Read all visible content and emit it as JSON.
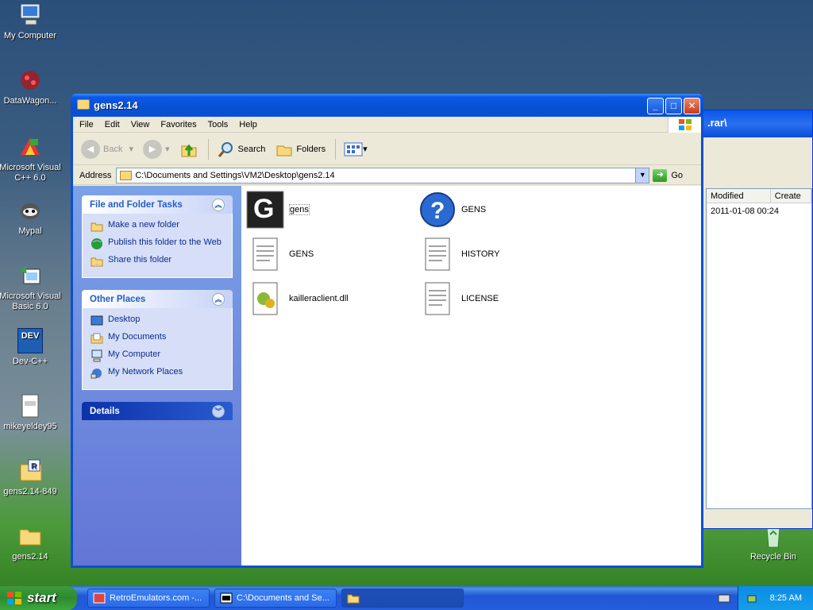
{
  "desktop": {
    "icons": [
      {
        "label": "My Computer"
      },
      {
        "label": "DataWagon..."
      },
      {
        "label": "Microsoft Visual C++ 6.0"
      },
      {
        "label": "Mypal"
      },
      {
        "label": "Microsoft Visual Basic 6.0"
      },
      {
        "label": "Dev-C++"
      },
      {
        "label": "mikeyeldey95"
      },
      {
        "label": "gens2.14-849"
      },
      {
        "label": "gens2.14"
      },
      {
        "label": "Recycle Bin"
      }
    ],
    "dev_icon_text": "DEV"
  },
  "back_window": {
    "title": ".rar\\",
    "columns": [
      "Modified",
      "Create"
    ],
    "rows": [
      {
        "modified": "2011-01-08 00:24"
      }
    ]
  },
  "window": {
    "title": "gens2.14",
    "menu": [
      "File",
      "Edit",
      "View",
      "Favorites",
      "Tools",
      "Help"
    ],
    "toolbar": {
      "back": "Back",
      "search": "Search",
      "folders": "Folders"
    },
    "address": {
      "label": "Address",
      "value": "C:\\Documents and Settings\\VM2\\Desktop\\gens2.14",
      "go": "Go"
    },
    "tasks_panel": {
      "title": "File and Folder Tasks",
      "items": [
        "Make a new folder",
        "Publish this folder to the Web",
        "Share this folder"
      ]
    },
    "places_panel": {
      "title": "Other Places",
      "items": [
        "Desktop",
        "My Documents",
        "My Computer",
        "My Network Places"
      ]
    },
    "details_panel": {
      "title": "Details"
    },
    "files": [
      {
        "name": "gens",
        "icon": "gens-app-icon"
      },
      {
        "name": "GENS",
        "icon": "help-file-icon"
      },
      {
        "name": "GENS",
        "icon": "text-file-icon"
      },
      {
        "name": "HISTORY",
        "icon": "text-file-icon"
      },
      {
        "name": "kailleraclient.dll",
        "icon": "dll-file-icon"
      },
      {
        "name": "LICENSE",
        "icon": "text-file-icon"
      }
    ]
  },
  "taskbar": {
    "start": "start",
    "items": [
      {
        "label": "RetroEmulators.com -..."
      },
      {
        "label": "C:\\Documents and Se..."
      },
      {
        "label": ""
      }
    ],
    "clock": "8:25 AM"
  }
}
